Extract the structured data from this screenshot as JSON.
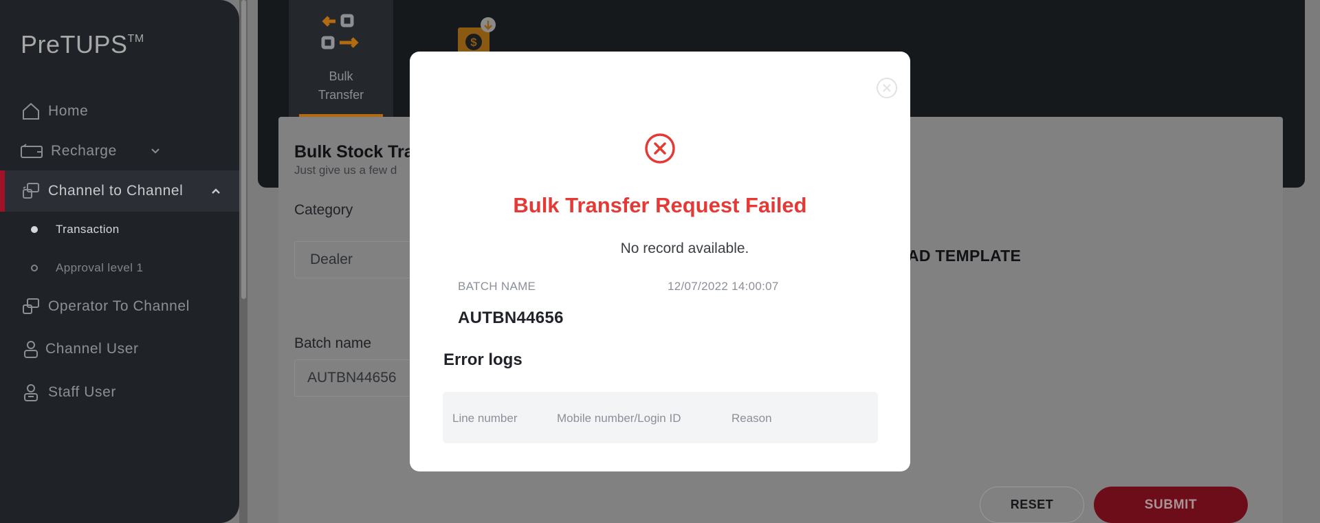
{
  "app": {
    "logo": "PreTUPS",
    "logo_tm": "TM"
  },
  "sidebar": {
    "items": [
      {
        "label": "Home",
        "icon": "home-icon"
      },
      {
        "label": "Recharge",
        "icon": "recharge-icon"
      },
      {
        "label": "Channel to Channel",
        "icon": "channel-transfer-icon"
      },
      {
        "label": "Operator To Channel",
        "icon": "operator-transfer-icon"
      },
      {
        "label": "Channel User",
        "icon": "user-icon"
      },
      {
        "label": "Staff User",
        "icon": "staff-user-icon"
      }
    ],
    "sub_items": [
      {
        "label": "Transaction"
      },
      {
        "label": "Approval level 1"
      }
    ]
  },
  "tabs": {
    "bulk_transfer": {
      "line1": "Bulk",
      "line2": "Transfer"
    }
  },
  "form": {
    "title": "Bulk Stock Tra",
    "subtitle": "Just give us a few d",
    "category_label": "Category",
    "category_value": "Dealer",
    "batch_label": "Batch name",
    "batch_value": "AUTBN44656",
    "template_label": "AD TEMPLATE",
    "reset_label": "RESET",
    "submit_label": "SUBMIT"
  },
  "modal": {
    "title": "Bulk Transfer Request Failed",
    "message": "No record available.",
    "batch_name_label": "BATCH NAME",
    "timestamp": "12/07/2022 14:00:07",
    "batch_name_value": "AUTBN44656",
    "error_logs_title": "Error logs",
    "columns": [
      "Line number",
      "Mobile number/Login ID",
      "Reason"
    ]
  },
  "colors": {
    "error": "#e53935",
    "accent": "#a01227",
    "tab_accent": "#b26b10"
  }
}
